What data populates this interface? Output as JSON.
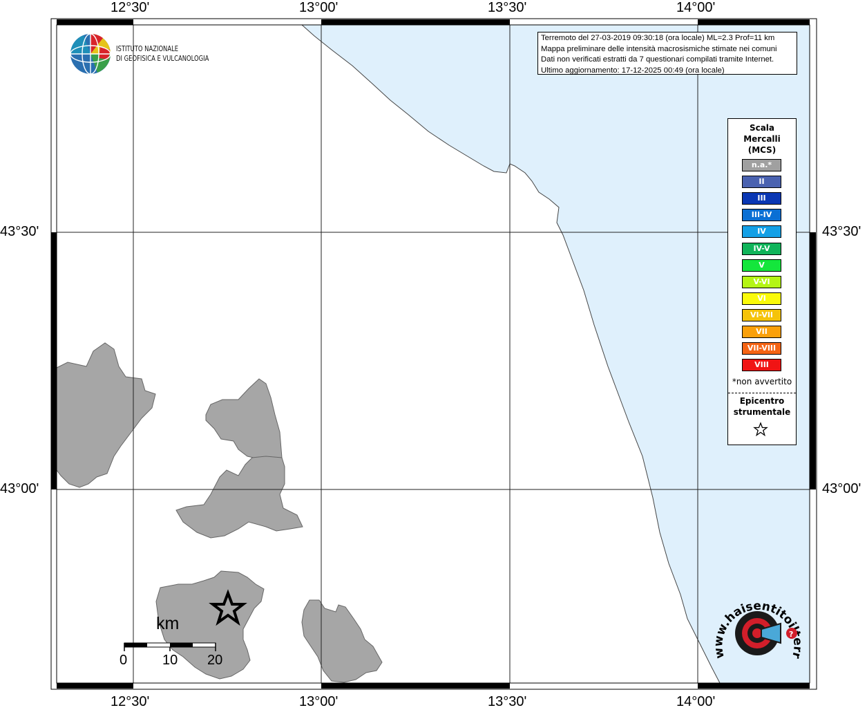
{
  "map": {
    "longitude_ticks": [
      "12°30'",
      "13°00'",
      "13°30'",
      "14°00'"
    ],
    "latitude_ticks": [
      "43°30'",
      "43°00'"
    ],
    "sea_color": "#dff0fc",
    "land_color": "#ffffff",
    "region_color": "#a6a6a6",
    "epicenter_marker": "star-icon"
  },
  "logo": {
    "line1": "ISTITUTO NAZIONALE",
    "line2": "DI GEOFISICA E VULCANOLOGIA",
    "icon": "ingv-globe-icon"
  },
  "info": {
    "line1": "Terremoto del 27-03-2019 09:30:18 (ora locale) ML=2.3 Prof=11 km",
    "line2": "Mappa preliminare delle intensità macrosismiche stimate nei comuni",
    "line3": "Dati non verificati estratti da 7 questionari compilati tramite Internet.",
    "line4": "Ultimo aggiornamento: 17-12-2025 00:49 (ora locale)"
  },
  "legend": {
    "title1": "Scala",
    "title2": "Mercalli",
    "title3": "(MCS)",
    "items": [
      {
        "label": "n.a.*",
        "color": "#a0a0a0"
      },
      {
        "label": "II",
        "color": "#4a62b0"
      },
      {
        "label": "III",
        "color": "#0a37b4"
      },
      {
        "label": "III-IV",
        "color": "#0a6fd4"
      },
      {
        "label": "IV",
        "color": "#14a0e6"
      },
      {
        "label": "IV-V",
        "color": "#10b45a"
      },
      {
        "label": "V",
        "color": "#14e63c"
      },
      {
        "label": "V-VI",
        "color": "#b4f514"
      },
      {
        "label": "VI",
        "color": "#fafa0a"
      },
      {
        "label": "VI-VII",
        "color": "#f5c30a"
      },
      {
        "label": "VII",
        "color": "#faa00a"
      },
      {
        "label": "VII-VIII",
        "color": "#f56414"
      },
      {
        "label": "VIII",
        "color": "#f01414"
      }
    ],
    "note": "*non avvertito",
    "epicenter_line1": "Epicentro",
    "epicenter_line2": "strumentale"
  },
  "scalebar": {
    "unit": "km",
    "labels": [
      "0",
      "10",
      "20"
    ]
  },
  "brand": {
    "text": "www.haisentitoilterremoto.it",
    "icon": "haisentito-logo-icon"
  }
}
